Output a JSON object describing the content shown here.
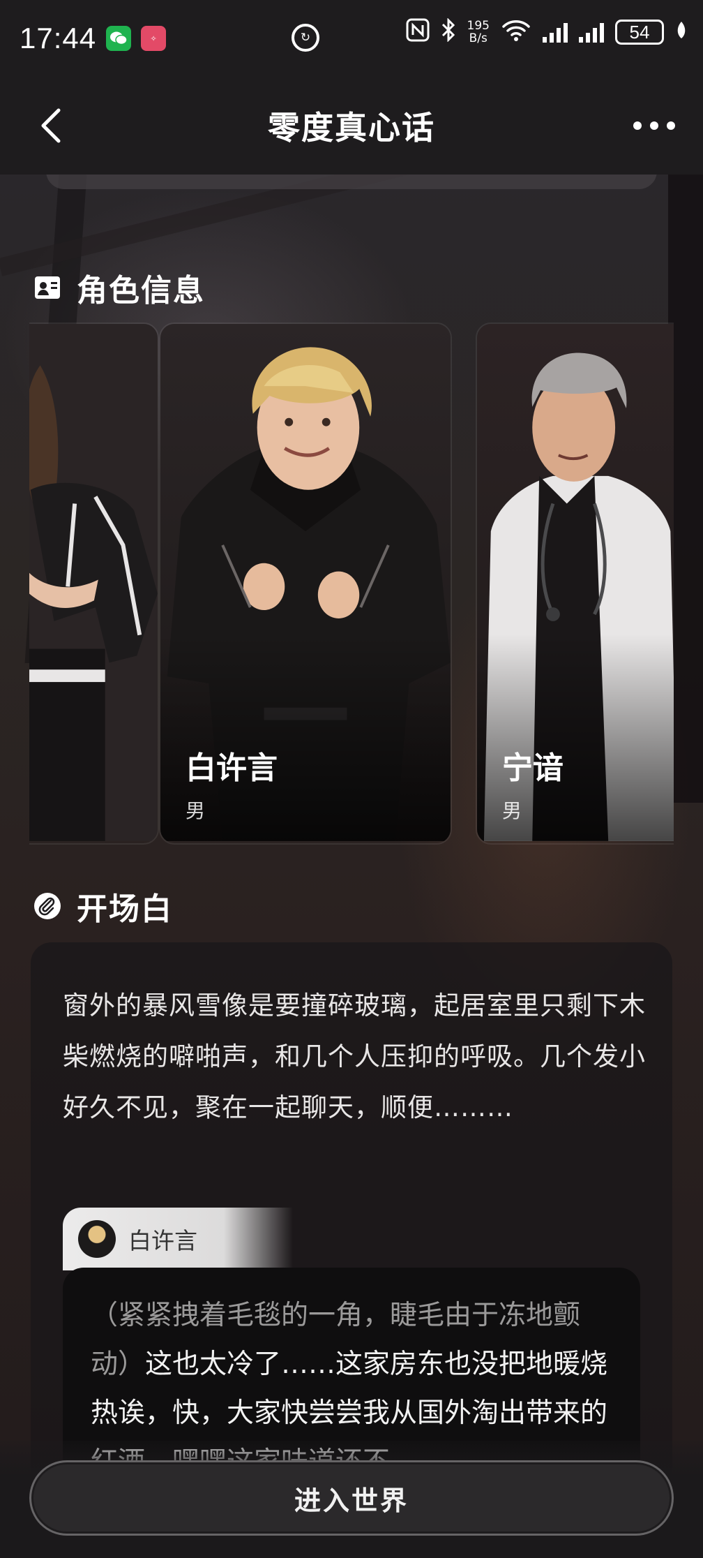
{
  "status_bar": {
    "time": "17:44",
    "net_speed_value": "195",
    "net_speed_unit": "B/s",
    "battery": "54"
  },
  "header": {
    "title": "零度真心话"
  },
  "sections": {
    "characters_title": "角色信息",
    "opening_title": "开场白"
  },
  "characters": [
    {
      "name": "",
      "gender": ""
    },
    {
      "name": "白许言",
      "gender": "男"
    },
    {
      "name": "宁谙",
      "gender": "男"
    }
  ],
  "opening": {
    "text": "窗外的暴风雪像是要撞碎玻璃，起居室里只剩下木柴燃烧的噼啪声，和几个人压抑的呼吸。几个发小好久不见，聚在一起聊天，顺便………",
    "speaker": "白许言",
    "dialog_action": "（紧紧拽着毛毯的一角，睫毛由于冻地颤动）",
    "dialog_speech": "这也太冷了……这家房东也没把地暖烧热诶，快，大家快尝尝我从国外淘出带来的红酒，嘿嘿这家味道还不"
  },
  "footer": {
    "enter_button": "进入世界"
  },
  "colors": {
    "background": "#1c1a1b",
    "card_bg": "#2a2324",
    "button_bg": "#2b292b"
  }
}
